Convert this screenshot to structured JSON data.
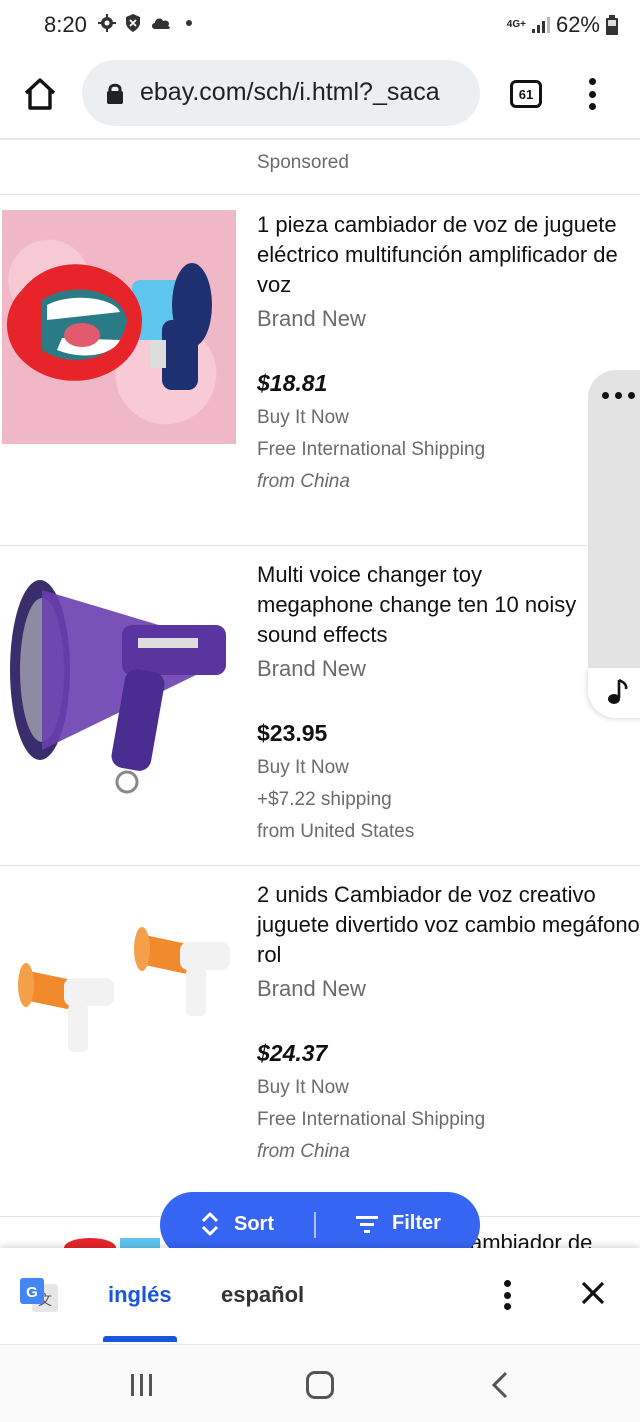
{
  "status": {
    "time": "8:20",
    "network": "4G+",
    "battery": "62%"
  },
  "browser": {
    "url": "ebay.com/sch/i.html?_saca",
    "tab_count": "61"
  },
  "listing": {
    "sponsored_label": "Sponsored",
    "items": [
      {
        "title": "1 pieza cambiador de voz de juguete eléctrico multifunción amplificador de voz",
        "condition": "Brand New",
        "price": "$18.81",
        "buy_format": "Buy It Now",
        "shipping": "Free International Shipping",
        "location": "from China"
      },
      {
        "title": "Multi voice changer toy megaphone change ten 10 noisy sound effects",
        "condition": "Brand New",
        "price": "$23.95",
        "buy_format": "Buy It Now",
        "shipping": "+$7.22 shipping",
        "location": "from United States"
      },
      {
        "title": "2 unids Cambiador de voz creativo juguete divertido voz cambio megáfono rol",
        "condition": "Brand New",
        "price": "$24.37",
        "buy_format": "Buy It Now",
        "shipping": "Free International Shipping",
        "location": "from China"
      }
    ],
    "peek_text": "ambiador de"
  },
  "sort_filter": {
    "sort_label": "Sort",
    "filter_label": "Filter"
  },
  "translate": {
    "source_lang": "inglés",
    "target_lang": "español"
  },
  "colors": {
    "accent": "#3665f3",
    "translate_active": "#1a56db"
  }
}
